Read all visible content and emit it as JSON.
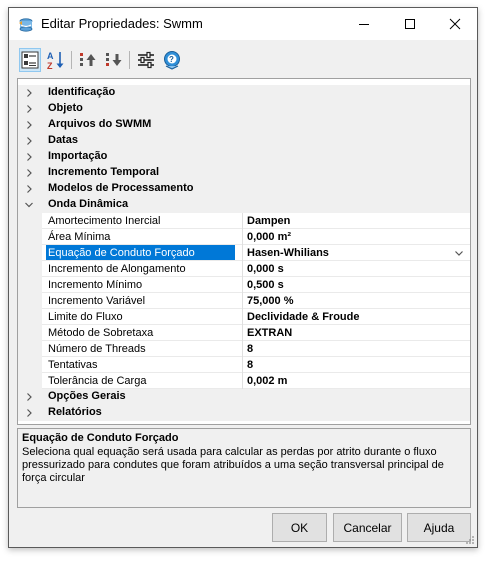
{
  "window": {
    "title": "Editar Propriedades: Swmm",
    "controls": [
      "minimize",
      "maximize",
      "close"
    ]
  },
  "toolbar": {
    "buttons": [
      {
        "name": "categorized-view",
        "active": true
      },
      {
        "name": "alphabetical-sort",
        "active": false
      },
      {
        "name": "move-up",
        "active": false
      },
      {
        "name": "move-down",
        "active": false
      },
      {
        "name": "property-pages",
        "active": false
      },
      {
        "name": "help",
        "active": false
      }
    ]
  },
  "grid": {
    "categories_top": [
      {
        "label": "Identificação",
        "expanded": false
      },
      {
        "label": "Objeto",
        "expanded": false
      },
      {
        "label": "Arquivos do SWMM",
        "expanded": false
      },
      {
        "label": "Datas",
        "expanded": false
      },
      {
        "label": "Importação",
        "expanded": false
      },
      {
        "label": "Incremento Temporal",
        "expanded": false
      },
      {
        "label": "Modelos de Processamento",
        "expanded": false
      }
    ],
    "expanded_category": {
      "label": "Onda Dinâmica",
      "expanded": true
    },
    "properties": [
      {
        "name": "Amortecimento Inercial",
        "value": "Dampen"
      },
      {
        "name": "Área Mínima",
        "value": "0,000 m²"
      },
      {
        "name": "Equação de Conduto Forçado",
        "value": "Hasen-Whilians",
        "selected": true
      },
      {
        "name": "Incremento de Alongamento",
        "value": "0,000 s"
      },
      {
        "name": "Incremento Mínimo",
        "value": "0,500 s"
      },
      {
        "name": "Incremento Variável",
        "value": "75,000 %"
      },
      {
        "name": "Limite do Fluxo",
        "value": "Declividade & Froude"
      },
      {
        "name": "Método de Sobretaxa",
        "value": "EXTRAN"
      },
      {
        "name": "Número de Threads",
        "value": "8"
      },
      {
        "name": "Tentativas",
        "value": "8"
      },
      {
        "name": "Tolerância de Carga",
        "value": "0,002 m"
      }
    ],
    "categories_bottom": [
      {
        "label": "Opções Gerais",
        "expanded": false
      },
      {
        "label": "Relatórios",
        "expanded": false
      }
    ]
  },
  "help": {
    "title": "Equação de Conduto Forçado",
    "description": "Seleciona qual equação será usada para calcular as perdas por atrito durante o fluxo pressurizado para condutes que foram atribuídos a uma seção transversal principal de força circular"
  },
  "buttons": {
    "ok": "OK",
    "cancel": "Cancelar",
    "help": "Ajuda"
  },
  "colors": {
    "selection": "#0078d7",
    "category_bg": "#f0f0f0",
    "window_bg": "#f0f0f0"
  }
}
